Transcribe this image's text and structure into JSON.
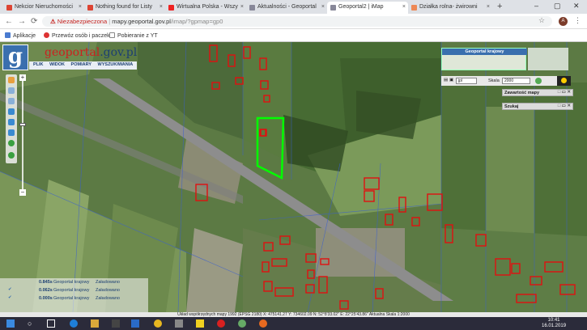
{
  "browser": {
    "tabs": [
      {
        "label": "Nekcior Nieruchomości",
        "close": "×"
      },
      {
        "label": "Nothing found for Listy",
        "close": "×"
      },
      {
        "label": "Wirtualna Polska - Wszy",
        "close": "×"
      },
      {
        "label": "Aktualności - Geoportal",
        "close": "×"
      },
      {
        "label": "Geoportal2 | iMap",
        "close": "×"
      },
      {
        "label": "Działka rolna- żwirowni",
        "close": "×"
      }
    ],
    "new_tab": "+",
    "window_controls": [
      "–",
      "▢",
      "✕"
    ],
    "security_label": "Niezabezpieczona",
    "url_host": "mapy.geoportal.gov.pl",
    "url_path": "/imap/?gpmap=gp0",
    "avatar": "A",
    "bookmarks": [
      "Aplikacje",
      "Przewóz osób i paczek",
      "Pobieranie z YT"
    ]
  },
  "geoportal": {
    "logo_letter": "g",
    "logo_text_1": "geoportal",
    "logo_text_2": ".gov.pl",
    "menu": [
      "PLIK",
      "WIDOK",
      "POMIARY",
      "WYSZUKIWANIA"
    ],
    "overview_title": "Geoportal krajowy",
    "format": "jpl",
    "scale_label": "Skala",
    "scale_value": "2000",
    "panel_content": "Zawartość mapy",
    "panel_search": "Szukaj",
    "layers": [
      {
        "value": "0.845s",
        "name": "Geoportal krajowy",
        "status": "Załadowano"
      },
      {
        "value": "0.062s",
        "name": "Geoportal krajowy",
        "status": "Załadowano"
      },
      {
        "value": "0.000s",
        "name": "Geoportal krajowy",
        "status": "Załadowano"
      }
    ],
    "status_bar": "Układ współrzędnych mapy 1992 (EPSG 2180)  X: 475141.27 Y: 734602.09  N: 52°8'33.02\" E: 22°25'43.86\"  Aktualna Skala 1:2000"
  },
  "taskbar": {
    "time": "10:41",
    "date": "16.01.2019"
  },
  "colors": {
    "parcel_outline": "#00ff00",
    "building_outline": "#e01010",
    "map_green": "#5d7b45"
  }
}
